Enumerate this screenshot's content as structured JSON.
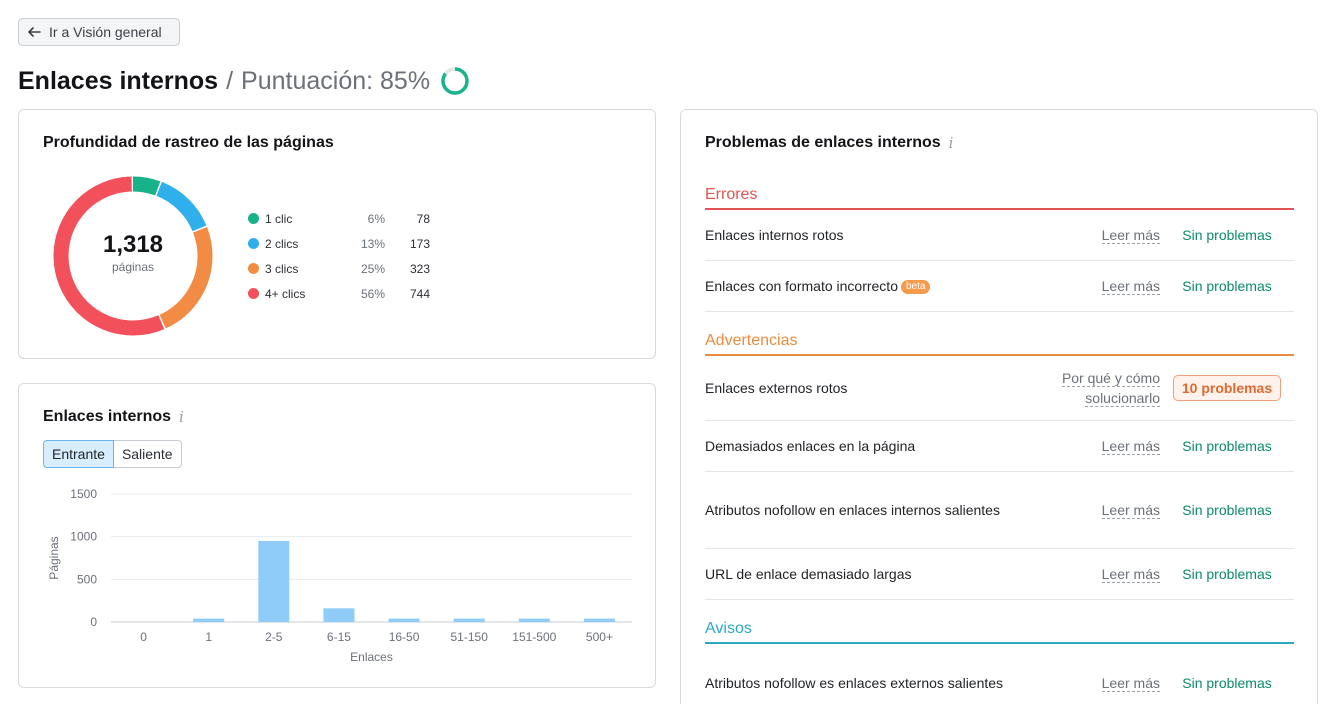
{
  "back_button": {
    "label": "Ir a Visión general",
    "icon": "arrow-left-icon"
  },
  "header": {
    "title": "Enlaces internos",
    "separator": "/",
    "score_label": "Puntuación: 85%",
    "score_value": 85,
    "score_color": "#1bb38d"
  },
  "depth_card": {
    "title": "Profundidad de rastreo de las páginas",
    "total": "1,318",
    "total_label": "páginas",
    "legend": [
      {
        "name": "1 clic",
        "pct": "6%",
        "count": "78",
        "color": "#17b28a"
      },
      {
        "name": "2 clics",
        "pct": "13%",
        "count": "173",
        "color": "#2fb0ec"
      },
      {
        "name": "3 clics",
        "pct": "25%",
        "count": "323",
        "color": "#f28c45"
      },
      {
        "name": "4+ clics",
        "pct": "56%",
        "count": "744",
        "color": "#f2505a"
      }
    ]
  },
  "links_card": {
    "title": "Enlaces internos",
    "info_icon": "i",
    "tabs": [
      {
        "label": "Entrante",
        "active": true
      },
      {
        "label": "Saliente",
        "active": false
      }
    ]
  },
  "chart_data": {
    "type": "bar",
    "categories": [
      "0",
      "1",
      "2-5",
      "6-15",
      "16-50",
      "51-150",
      "151-500",
      "500+"
    ],
    "values": [
      0,
      40,
      950,
      160,
      40,
      40,
      40,
      40
    ],
    "xlabel": "Enlaces",
    "ylabel": "Páginas",
    "ylim": [
      0,
      1500
    ],
    "yticks": [
      0,
      500,
      1000,
      1500
    ],
    "grid": true,
    "color": "#8fccf9"
  },
  "issues_card": {
    "title": "Problemas de enlaces internos",
    "info_icon": "i",
    "sections": [
      {
        "name": "Errores",
        "color": "#e05454",
        "rows": [
          {
            "label": "Enlaces internos rotos",
            "more": "Leer más",
            "status": "Sin problemas"
          },
          {
            "label": "Enlaces con formato incorrecto",
            "badge": "beta",
            "more": "Leer más",
            "status": "Sin problemas"
          }
        ]
      },
      {
        "name": "Advertencias",
        "color": "#e88d40",
        "rows": [
          {
            "label": "Enlaces externos rotos",
            "more": "Por qué y cómo solucionarlo",
            "status": "10 problemas"
          },
          {
            "label": "Demasiados enlaces en la página",
            "more": "Leer más",
            "status": "Sin problemas"
          },
          {
            "label": "Atributos nofollow en enlaces internos salientes",
            "more": "Leer más",
            "status": "Sin problemas"
          },
          {
            "label": "URL de enlace demasiado largas",
            "more": "Leer más",
            "status": "Sin problemas"
          }
        ]
      },
      {
        "name": "Avisos",
        "color": "#2ca8c6",
        "rows": [
          {
            "label": "Atributos nofollow es enlaces externos salientes",
            "more": "Leer más",
            "status": "Sin problemas"
          }
        ]
      }
    ]
  }
}
